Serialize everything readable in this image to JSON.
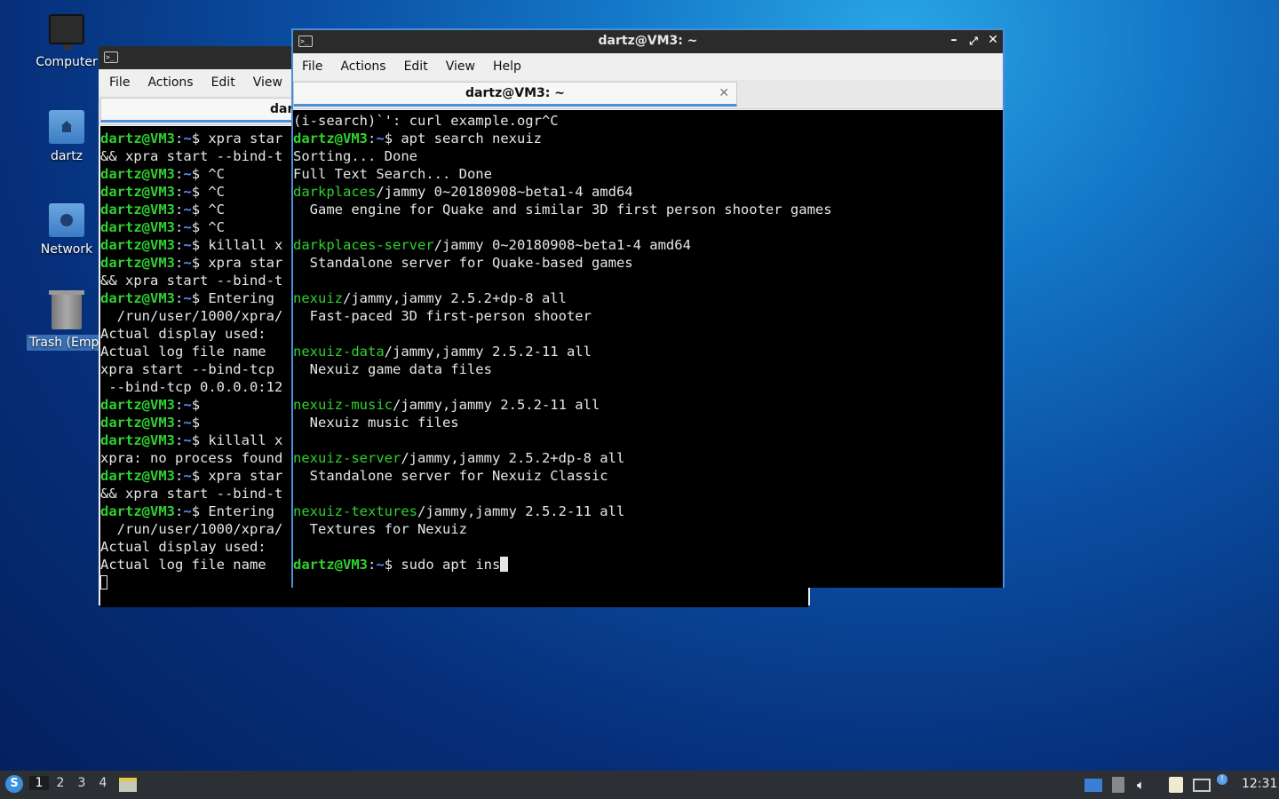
{
  "desktop": {
    "icons": [
      {
        "label": "Computer",
        "icon": "computer-icon"
      },
      {
        "label": "dartz",
        "icon": "home-folder-icon"
      },
      {
        "label": "Network",
        "icon": "network-folder-icon"
      },
      {
        "label": "Trash (Empt",
        "icon": "trash-icon"
      }
    ]
  },
  "back_window": {
    "menu": [
      "File",
      "Actions",
      "Edit",
      "View"
    ],
    "tab_title": "dar",
    "lines": [
      {
        "prompt": "dartz@VM3",
        "path": "~",
        "text": "$ xpra star"
      },
      {
        "text": "&& xpra start --bind-t"
      },
      {
        "prompt": "dartz@VM3",
        "path": "~",
        "text": "$ ^C"
      },
      {
        "prompt": "dartz@VM3",
        "path": "~",
        "text": "$ ^C"
      },
      {
        "prompt": "dartz@VM3",
        "path": "~",
        "text": "$ ^C"
      },
      {
        "prompt": "dartz@VM3",
        "path": "~",
        "text": "$ ^C"
      },
      {
        "prompt": "dartz@VM3",
        "path": "~",
        "text": "$ killall x"
      },
      {
        "prompt": "dartz@VM3",
        "path": "~",
        "text": "$ xpra star"
      },
      {
        "text": "&& xpra start --bind-t"
      },
      {
        "prompt": "dartz@VM3",
        "path": "~",
        "text": "$ Entering"
      },
      {
        "text": "  /run/user/1000/xpra/"
      },
      {
        "text": "Actual display used: "
      },
      {
        "text": "Actual log file name "
      },
      {
        "text": "xpra start --bind-tcp "
      },
      {
        "text": " --bind-tcp 0.0.0.0:12"
      },
      {
        "prompt": "dartz@VM3",
        "path": "~",
        "text": "$"
      },
      {
        "prompt": "dartz@VM3",
        "path": "~",
        "text": "$"
      },
      {
        "prompt": "dartz@VM3",
        "path": "~",
        "text": "$ killall x"
      },
      {
        "text": "xpra: no process found"
      },
      {
        "prompt": "dartz@VM3",
        "path": "~",
        "text": "$ xpra star"
      },
      {
        "text": "&& xpra start --bind-t"
      },
      {
        "prompt": "dartz@VM3",
        "path": "~",
        "text": "$ Entering"
      },
      {
        "text": "  /run/user/1000/xpra/"
      },
      {
        "text": "Actual display used: "
      },
      {
        "text": "Actual log file name "
      }
    ]
  },
  "front_window": {
    "title": "dartz@VM3: ~",
    "menu": [
      "File",
      "Actions",
      "Edit",
      "View",
      "Help"
    ],
    "tab_title": "dartz@VM3: ~",
    "lines": [
      {
        "text": "(i-search)`': curl example.ogr^C"
      },
      {
        "prompt": "dartz@VM3",
        "path": "~",
        "text": "$ apt search nexuiz"
      },
      {
        "text": "Sorting... Done"
      },
      {
        "text": "Full Text Search... Done"
      },
      {
        "pkg": "darkplaces",
        "text": "/jammy 0~20180908~beta1-4 amd64"
      },
      {
        "text": "  Game engine for Quake and similar 3D first person shooter games"
      },
      {
        "text": ""
      },
      {
        "pkg": "darkplaces-server",
        "text": "/jammy 0~20180908~beta1-4 amd64"
      },
      {
        "text": "  Standalone server for Quake-based games"
      },
      {
        "text": ""
      },
      {
        "pkg": "nexuiz",
        "text": "/jammy,jammy 2.5.2+dp-8 all"
      },
      {
        "text": "  Fast-paced 3D first-person shooter"
      },
      {
        "text": ""
      },
      {
        "pkg": "nexuiz-data",
        "text": "/jammy,jammy 2.5.2-11 all"
      },
      {
        "text": "  Nexuiz game data files"
      },
      {
        "text": ""
      },
      {
        "pkg": "nexuiz-music",
        "text": "/jammy,jammy 2.5.2-11 all"
      },
      {
        "text": "  Nexuiz music files"
      },
      {
        "text": ""
      },
      {
        "pkg": "nexuiz-server",
        "text": "/jammy,jammy 2.5.2+dp-8 all"
      },
      {
        "text": "  Standalone server for Nexuiz Classic"
      },
      {
        "text": ""
      },
      {
        "pkg": "nexuiz-textures",
        "text": "/jammy,jammy 2.5.2-11 all"
      },
      {
        "text": "  Textures for Nexuiz"
      },
      {
        "text": ""
      },
      {
        "prompt": "dartz@VM3",
        "path": "~",
        "text": "$ sudo apt ins",
        "cursor": true
      }
    ]
  },
  "taskbar": {
    "workspaces": [
      "1",
      "2",
      "3",
      "4"
    ],
    "active_workspace": "1",
    "clock": "12:31"
  }
}
